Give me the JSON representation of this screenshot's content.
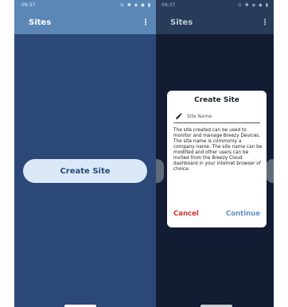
{
  "left": {
    "status": {
      "time": "09:37",
      "icons": "⊙ ✱ ◈ ◆ ▮"
    },
    "appbar": {
      "title": "Sites",
      "menu": "⋮"
    },
    "create_button": "Create Site"
  },
  "right": {
    "status": {
      "time": "09:37",
      "icons": "⊙ ✱ ◈ ◆ ▮"
    },
    "appbar": {
      "title": "Sites",
      "menu": "⋮"
    },
    "dialog": {
      "title": "Create Site",
      "name_placeholder": "Site Name",
      "description": "The site created can be used to monitor and manage Breezy Devices. The site name is commonly a company name. The site name can be modified and other users can be invited from the Breezy Cloud dashboard in your internet browser of choice.",
      "cancel_label": "Cancel",
      "continue_label": "Continue"
    }
  },
  "colors": {
    "appbar_left": "#5b87b7",
    "background_left": "#2b4878",
    "scrim_right": "#121d33",
    "cancel": "#d32f2f",
    "continue": "#5e8fc6"
  },
  "icons": {
    "pencil": "pencil-icon",
    "menu": "more-vertical-icon"
  }
}
